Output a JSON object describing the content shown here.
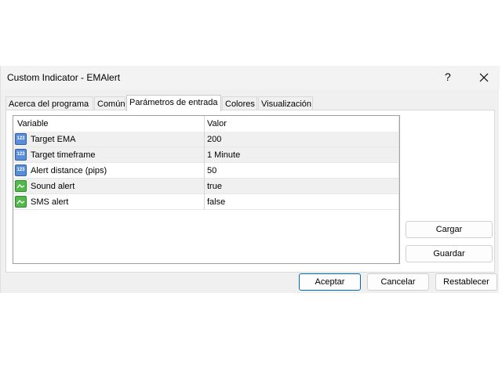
{
  "window": {
    "title": "Custom Indicator - EMAlert",
    "help_label": "?"
  },
  "tabs": [
    {
      "label": "Acerca del programa",
      "active": false
    },
    {
      "label": "Común",
      "active": false
    },
    {
      "label": "Parámetros de entrada",
      "active": true
    },
    {
      "label": "Colores",
      "active": false
    },
    {
      "label": "Visualización",
      "active": false
    }
  ],
  "table": {
    "headers": {
      "variable": "Variable",
      "value": "Valor"
    },
    "rows": [
      {
        "variable": "Target EMA",
        "value": "200",
        "icon": "number-123-icon"
      },
      {
        "variable": "Target timeframe",
        "value": "1 Minute",
        "icon": "number-123-icon"
      },
      {
        "variable": "Alert distance (pips)",
        "value": "50",
        "icon": "number-123-icon"
      },
      {
        "variable": "Sound alert",
        "value": "true",
        "icon": "boolean-toggle-icon"
      },
      {
        "variable": "SMS alert",
        "value": "false",
        "icon": "boolean-toggle-icon"
      }
    ]
  },
  "side_buttons": {
    "load": "Cargar",
    "save": "Guardar"
  },
  "footer_buttons": {
    "accept": "Aceptar",
    "cancel": "Cancelar",
    "reset": "Restablecer"
  },
  "colors": {
    "accent": "#0067c0",
    "number_icon": "#5b8ed8",
    "bool_icon": "#53b84b"
  }
}
